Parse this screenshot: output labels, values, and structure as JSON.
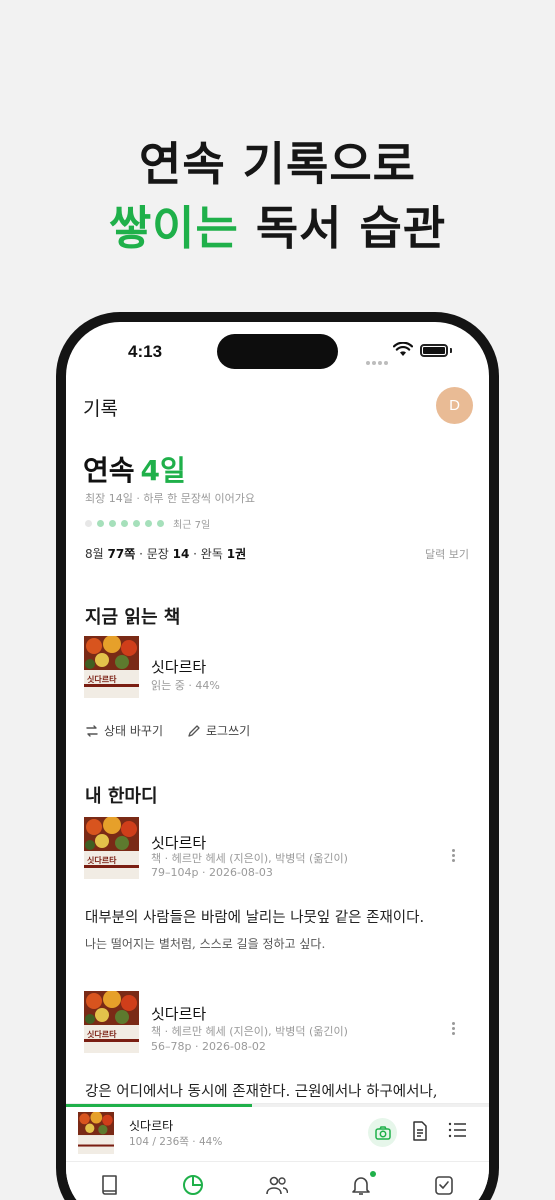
{
  "headline": {
    "line1": "연속 기록으로",
    "line2_accent": "쌓이는",
    "line2_rest": "독서 습관"
  },
  "status_bar": {
    "time": "4:13"
  },
  "header": {
    "title": "기록",
    "avatar_letter": "D"
  },
  "streak": {
    "label": "연속",
    "value": "4일",
    "subtitle": "최장 14일 · 하루 한 문장씩 이어가요",
    "week_label": "최근 7일",
    "week_days_filled": [
      false,
      true,
      true,
      true,
      true,
      true,
      true
    ]
  },
  "stats": {
    "month_label": "8월",
    "pages": "77쪽",
    "sentence_label": "문장",
    "sentences": "14",
    "finished_label": "완독",
    "finished": "1권",
    "calendar_link": "달력 보기"
  },
  "reading_now": {
    "section_title": "지금 읽는 책",
    "book_title": "싯다르타",
    "status": "읽는 중 · 44%",
    "progress_percent": 44,
    "change_status_label": "상태 바꾸기",
    "write_log_label": "로그쓰기"
  },
  "cover": {
    "title_text": "싯다르타"
  },
  "my_notes": {
    "section_title": "내 한마디",
    "entries": [
      {
        "title": "싯다르타",
        "meta1": "책 · 헤르만 헤세 (지은이), 박병덕 (옮긴이)",
        "meta2": "79–104p · 2026-08-03",
        "quote": "대부분의 사람들은 바람에 날리는 나뭇잎 같은 존재이다.",
        "note": "나는 떨어지는 별처럼, 스스로 길을 정하고 싶다."
      },
      {
        "title": "싯다르타",
        "meta1": "책 · 헤르만 헤세 (지은이), 박병덕 (옮긴이)",
        "meta2": "56–78p · 2026-08-02",
        "quote": "강은 어디에서나 동시에 존재한다. 근원에서나 하구에서나,"
      }
    ]
  },
  "mini_player": {
    "title": "싯다르타",
    "meta": "104 / 236쪽 · 44%",
    "progress_percent": 44
  },
  "tabs": [
    {
      "icon": "book-icon"
    },
    {
      "icon": "pie-chart-icon",
      "active": true
    },
    {
      "icon": "people-icon"
    },
    {
      "icon": "bell-icon",
      "has_badge": true
    },
    {
      "icon": "checkbox-icon"
    }
  ],
  "colors": {
    "accent": "#1fb04a",
    "avatar": "#e9bb95",
    "dot_filled": "#a6e0bb"
  }
}
